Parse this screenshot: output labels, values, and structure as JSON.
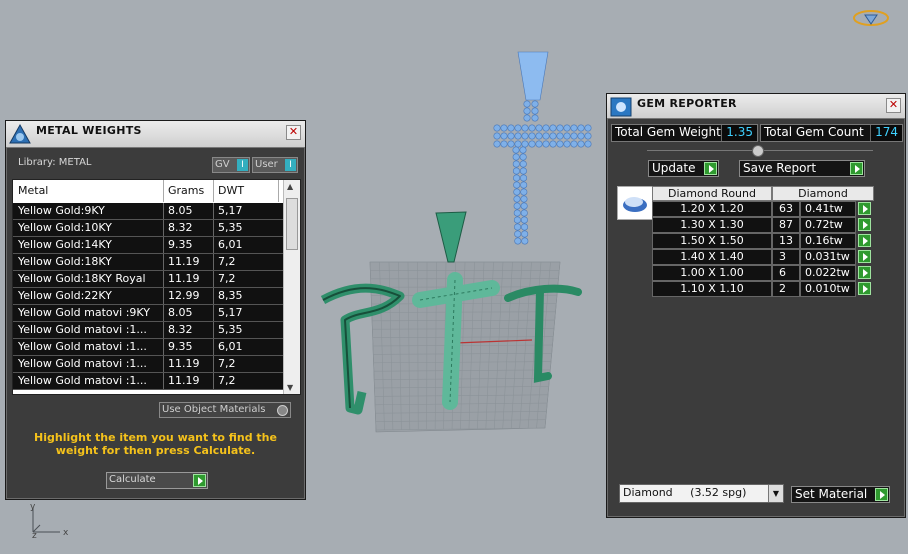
{
  "viewport": {
    "axis_labels": {
      "y": "y",
      "z": "z",
      "x": "x"
    }
  },
  "metal_panel": {
    "title": "METAL WEIGHTS",
    "library_label": "Library: METAL",
    "toggle_gv": "GV",
    "toggle_user": "User",
    "columns": [
      "Metal",
      "Grams",
      "DWT"
    ],
    "rows": [
      [
        "Yellow Gold:9KY",
        "8.05",
        "5,17"
      ],
      [
        "Yellow Gold:10KY",
        "8.32",
        "5,35"
      ],
      [
        "Yellow Gold:14KY",
        "9.35",
        "6,01"
      ],
      [
        "Yellow Gold:18KY",
        "11.19",
        "7,2"
      ],
      [
        "Yellow Gold:18KY Royal",
        "11.19",
        "7,2"
      ],
      [
        "Yellow Gold:22KY",
        "12.99",
        "8,35"
      ],
      [
        "Yellow Gold matovi :9KY",
        "8.05",
        "5,17"
      ],
      [
        "Yellow Gold matovi :1...",
        "8.32",
        "5,35"
      ],
      [
        "Yellow Gold matovi :1...",
        "9.35",
        "6,01"
      ],
      [
        "Yellow Gold matovi :1...",
        "11.19",
        "7,2"
      ],
      [
        "Yellow Gold matovi :1...",
        "11.19",
        "7,2"
      ]
    ],
    "use_object_materials": "Use Object Materials",
    "hint": "Highlight the item you want to find the weight for then press Calculate.",
    "calculate": "Calculate"
  },
  "gem_panel": {
    "title": "GEM REPORTER",
    "total_weight_label": "Total Gem Weight",
    "total_weight_value": "1.35",
    "total_count_label": "Total Gem Count",
    "total_count_value": "174",
    "update_button": "Update",
    "save_report_button": "Save Report",
    "col_shape": "Diamond Round",
    "col_material": "Diamond",
    "rows": [
      [
        "1.20 X 1.20",
        "63",
        "0.41tw"
      ],
      [
        "1.30 X 1.30",
        "87",
        "0.72tw"
      ],
      [
        "1.50 X 1.50",
        "13",
        "0.16tw"
      ],
      [
        "1.40 X 1.40",
        "3",
        "0.031tw"
      ],
      [
        "1.00 X 1.00",
        "6",
        "0.022tw"
      ],
      [
        "1.10 X 1.10",
        "2",
        "0.010tw"
      ]
    ],
    "material_select": "Diamond     (3.52 spg)",
    "set_material_button": "Set Material"
  }
}
